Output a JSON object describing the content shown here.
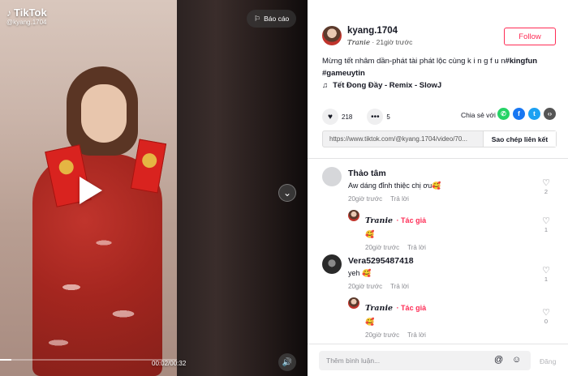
{
  "video": {
    "brand": "TikTok",
    "handle": "@kyang.1704",
    "report_label": "Báo cáo",
    "time": "00:02/00:32",
    "progress": 0.0625
  },
  "post": {
    "username": "kyang.1704",
    "nickname": "Tranie",
    "posted": "21giờ trước",
    "follow_label": "Follow",
    "caption_text": "Mừng tết nhâm dần-phát tài phát lộc cùng k i n g f u n",
    "hashtags": [
      "#kingfun",
      "#gameuytin"
    ],
    "music": "Tết Đong Đầy - Remix - SlowJ",
    "likes": "218",
    "comments": "5",
    "share_label": "Chia sẻ với",
    "link": "https://www.tiktok.com/@kyang.1704/video/70...",
    "copy_label": "Sao chép liên kết"
  },
  "comments": [
    {
      "name": "Thảo tâm",
      "text": "Aw dáng đỉnh thiệc chị ơu🥰",
      "time": "20giờ trước",
      "reply": "Trả lời",
      "likes": "2"
    },
    {
      "name": "Tranie",
      "tag": "· Tác giả",
      "text": "🥰",
      "time": "20giờ trước",
      "reply": "Trả lời",
      "likes": "1"
    },
    {
      "name": "Vera5295487418",
      "text": "yeh 🥰",
      "time": "20giờ trước",
      "reply": "Trả lời",
      "likes": "1"
    },
    {
      "name": "Tranie",
      "tag": "· Tác giả",
      "text": "🥰",
      "time": "20giờ trước",
      "reply": "Trả lời",
      "likes": "0"
    }
  ],
  "composer": {
    "placeholder": "Thêm bình luận...",
    "post_label": "Đăng"
  }
}
